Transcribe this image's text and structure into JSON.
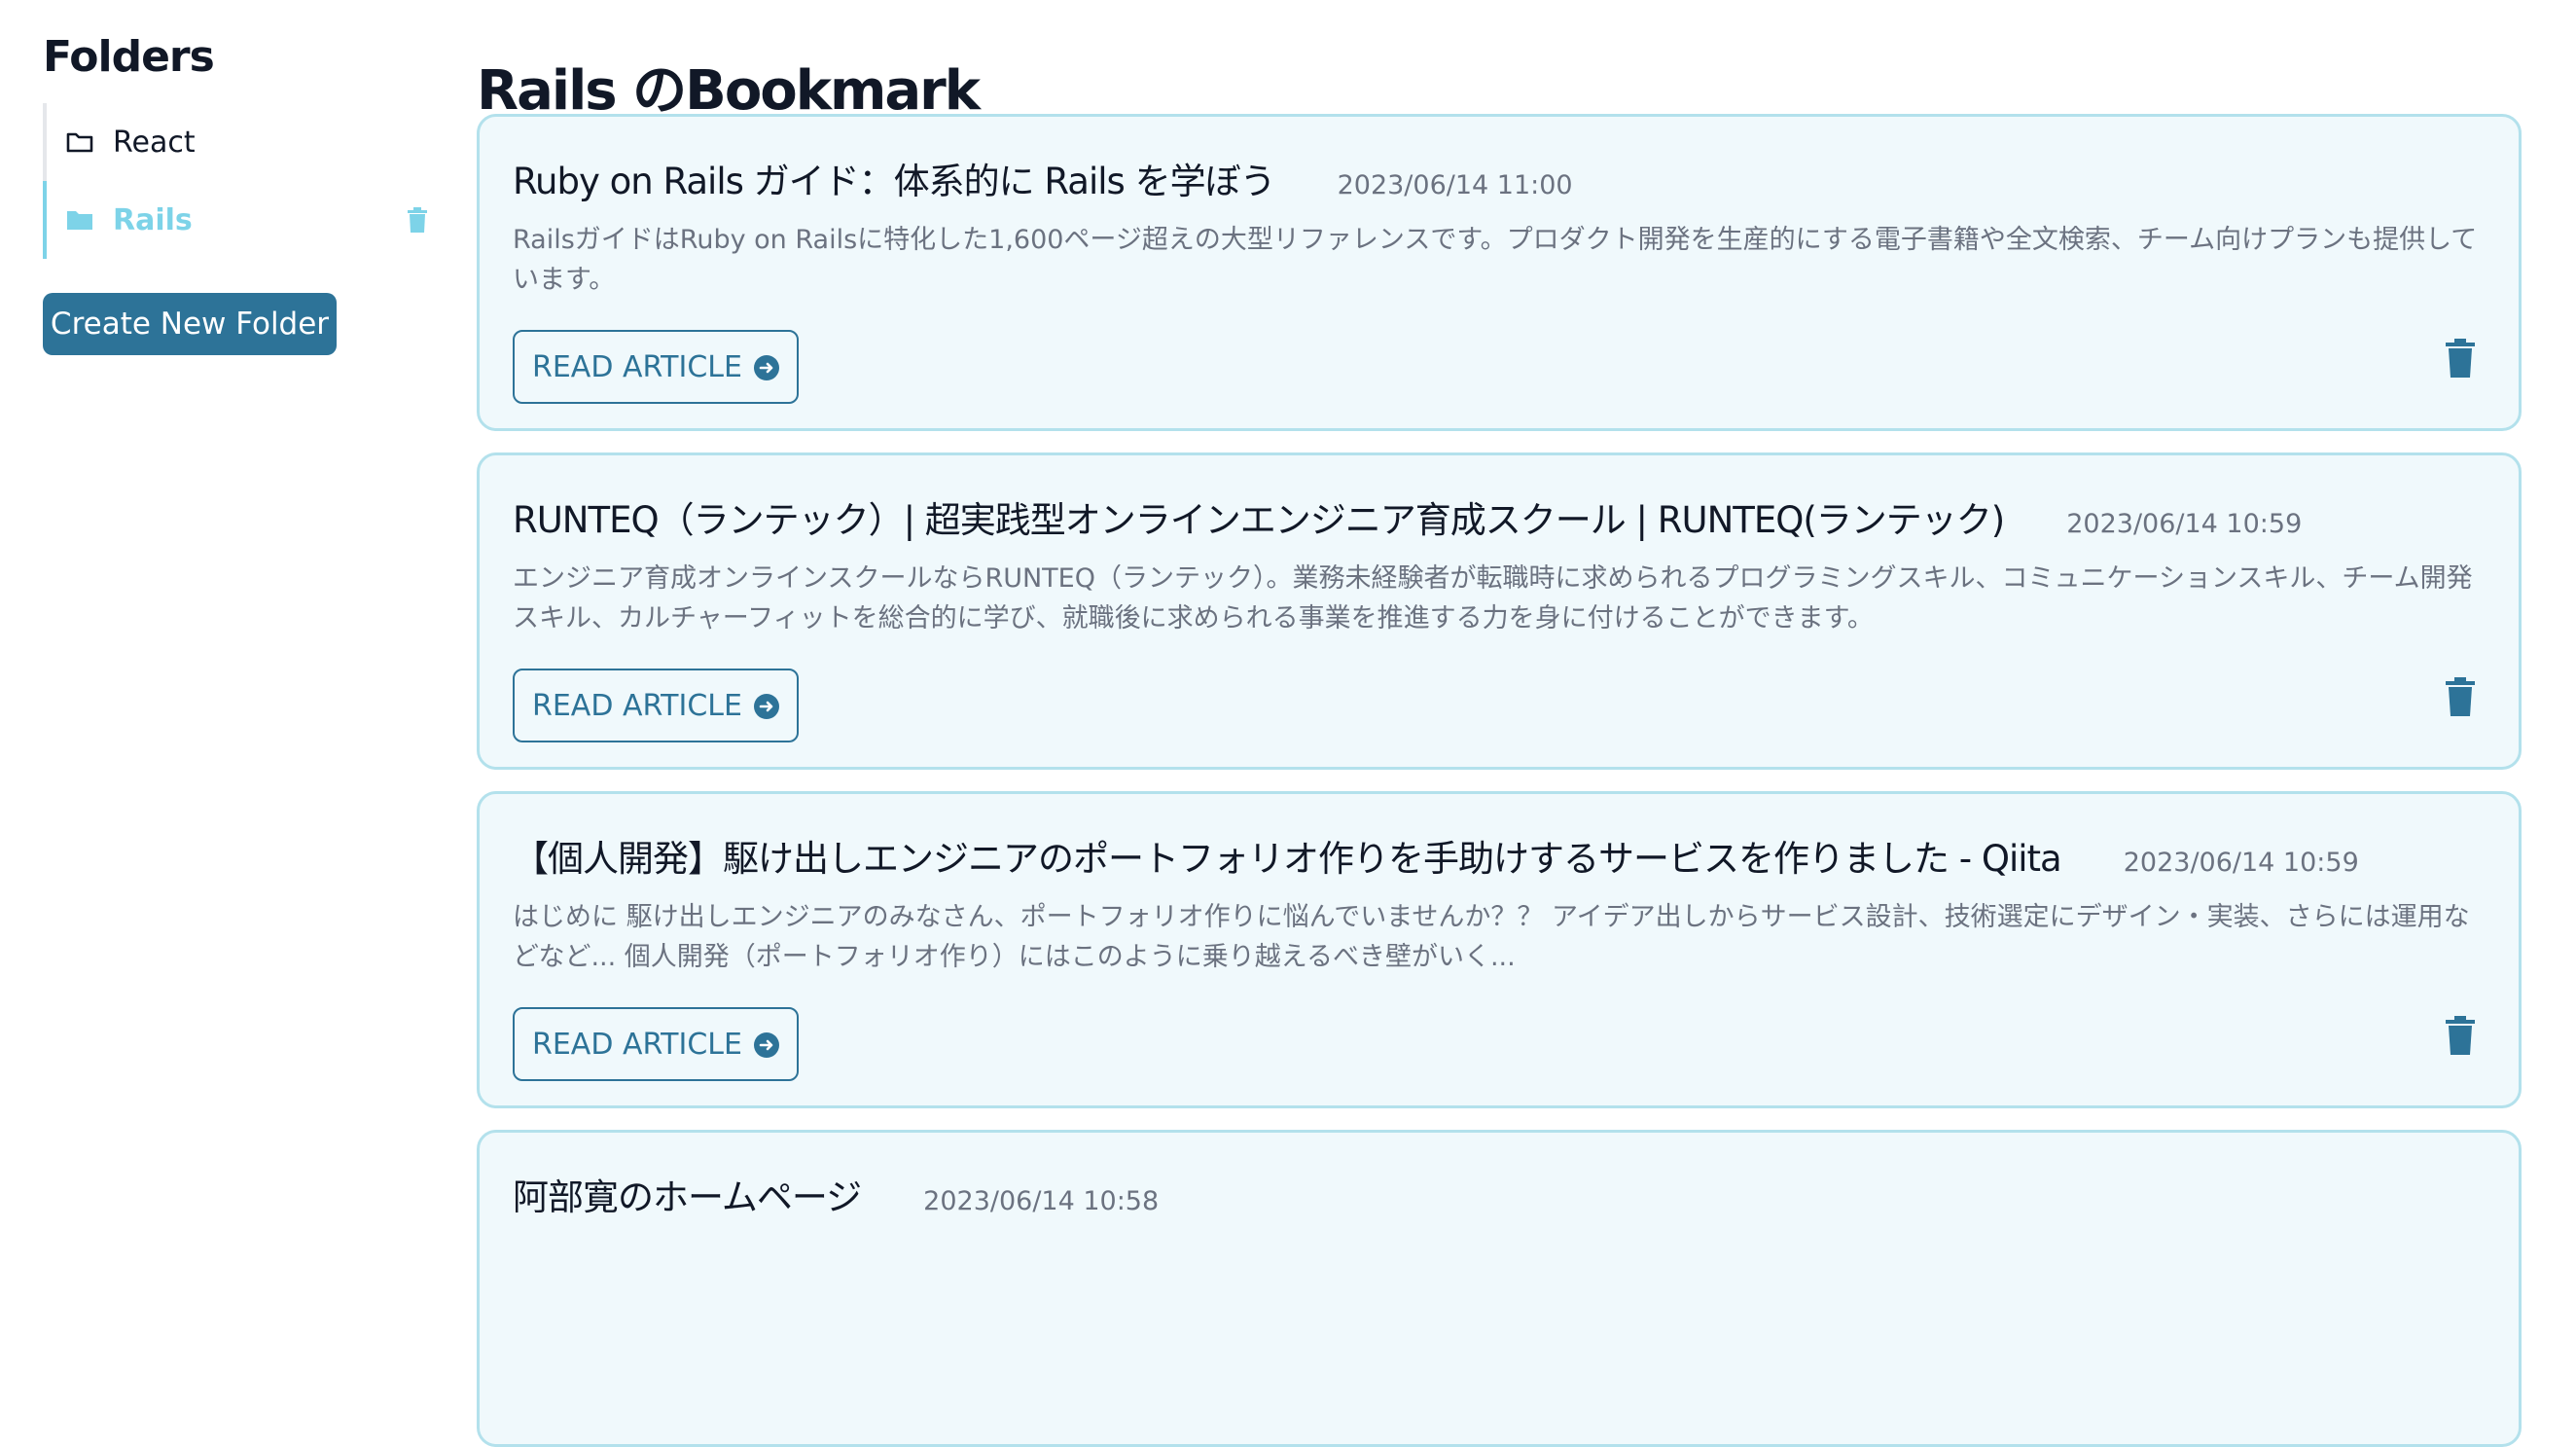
{
  "sidebar": {
    "title": "Folders",
    "folders": [
      {
        "name": "React",
        "active": false
      },
      {
        "name": "Rails",
        "active": true
      }
    ],
    "create_button": "Create New Folder"
  },
  "main": {
    "title": "Rails のBookmark",
    "read_label": "READ ARTICLE",
    "bookmarks": [
      {
        "title": "Ruby on Rails ガイド：体系的に Rails を学ぼう",
        "date": "2023/06/14 11:00",
        "description": "RailsガイドはRuby on Railsに特化した1,600ページ超えの大型リファレンスです。プロダクト開発を生産的にする電子書籍や全文検索、チーム向けプランも提供しています。"
      },
      {
        "title": "RUNTEQ（ランテック）| 超実践型オンラインエンジニア育成スクール | RUNTEQ(ランテック)",
        "date": "2023/06/14 10:59",
        "description": "エンジニア育成オンラインスクールならRUNTEQ（ランテック）。業務未経験者が転職時に求められるプログラミングスキル、コミュニケーションスキル、チーム開発スキル、カルチャーフィットを総合的に学び、就職後に求められる事業を推進する力を身に付けることができます。"
      },
      {
        "title": "【個人開発】駆け出しエンジニアのポートフォリオ作りを手助けするサービスを作りました - Qiita",
        "date": "2023/06/14 10:59",
        "description": "はじめに 駆け出しエンジニアのみなさん、ポートフォリオ作りに悩んでいませんか？？ アイデア出しからサービス設計、技術選定にデザイン・実装、さらには運用などなど... 個人開発（ポートフォリオ作り）にはこのように乗り越えるべき壁がいく..."
      },
      {
        "title": "阿部寛のホームページ",
        "date": "2023/06/14 10:58",
        "description": ""
      }
    ]
  },
  "icons": {
    "folder_outline": "folder-icon",
    "folder_filled": "folder-filled-icon",
    "trash": "trash-icon",
    "arrow_circle": "arrow-circle-right-icon"
  },
  "colors": {
    "accent": "#2d7398",
    "active": "#7dd3e8",
    "card_bg": "#f0f9fc",
    "card_border": "#b3e1ec"
  }
}
